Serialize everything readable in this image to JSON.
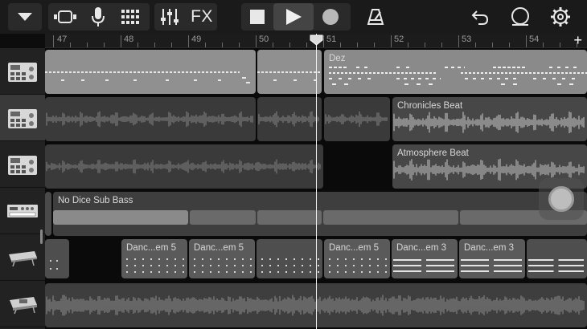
{
  "toolbar": {
    "fx_label": "FX",
    "icons": [
      "browser-dropdown-icon",
      "tracks-view-icon",
      "microphone-icon",
      "grid-icon",
      "mixer-icon",
      "fx-icon",
      "stop-icon",
      "play-icon",
      "record-icon",
      "metronome-icon",
      "undo-icon",
      "loop-icon",
      "settings-icon"
    ]
  },
  "ruler": {
    "bars": [
      "47",
      "48",
      "49",
      "50",
      "51",
      "52",
      "53",
      "54"
    ],
    "add_label": "+"
  },
  "tracks": [
    {
      "icon": "drum-machine-icon",
      "selected": false,
      "regions": [
        {
          "label": ""
        },
        {
          "label": ""
        },
        {
          "label": "Dez"
        }
      ]
    },
    {
      "icon": "drum-machine-icon",
      "selected": true,
      "regions": [
        {
          "label": ""
        },
        {
          "label": ""
        },
        {
          "label": "Chronicles Beat"
        }
      ]
    },
    {
      "icon": "drum-machine-icon",
      "selected": false,
      "regions": [
        {
          "label": ""
        },
        {
          "label": "Atmosphere Beat"
        }
      ]
    },
    {
      "icon": "synth-icon",
      "selected": false,
      "regions": [
        {
          "label": "No Dice Sub Bass"
        }
      ]
    },
    {
      "icon": "keyboard-icon",
      "selected": false,
      "regions": [
        {
          "label": ""
        },
        {
          "label": "Danc...em 5"
        },
        {
          "label": "Danc...em 5"
        },
        {
          "label": ""
        },
        {
          "label": "Danc...em 5"
        },
        {
          "label": "Danc...em 3"
        },
        {
          "label": "Danc...em 3"
        },
        {
          "label": ""
        }
      ]
    },
    {
      "icon": "keyboard-icon",
      "selected": false,
      "regions": [
        {
          "label": ""
        }
      ]
    }
  ]
}
